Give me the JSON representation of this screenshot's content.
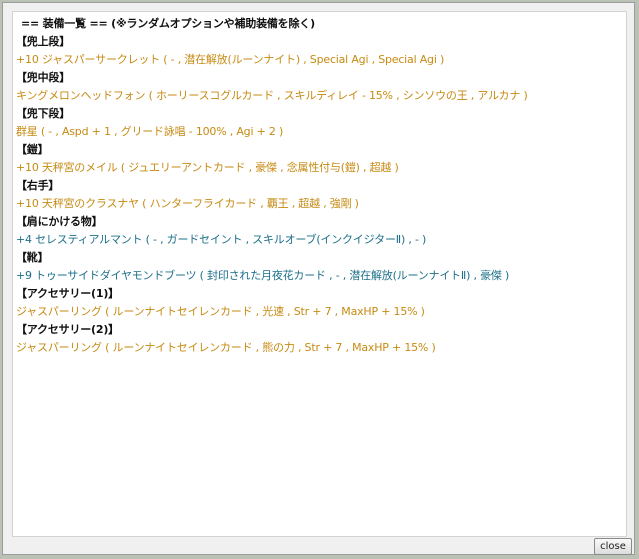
{
  "title": "== 装備一覧 == (※ランダムオプションや補助装備を除く)",
  "equipment": [
    {
      "slot": "【兜上段】",
      "item": "+10 ジャスパーサークレット ( - , 潜在解放(ルーンナイト) , Special Agi , Special Agi )",
      "color": "#c78a12"
    },
    {
      "slot": "【兜中段】",
      "item": "キングメロンヘッドフォン ( ホーリースコグルカード , スキルディレイ - 15% , シンソウの王 , アルカナ )",
      "color": "#c78a12"
    },
    {
      "slot": "【兜下段】",
      "item": "群星 ( - , Aspd + 1 , グリード詠唱 - 100% , Agi + 2 )",
      "color": "#c78a12"
    },
    {
      "slot": "【鎧】",
      "item": "+10 天秤宮のメイル ( ジュエリーアントカード , 豪傑 , 念属性付与(鎧) , 超越 )",
      "color": "#c78a12"
    },
    {
      "slot": "【右手】",
      "item": "+10 天秤宮のクラスナヤ ( ハンターフライカード , 覇王 , 超越 , 強剛 )",
      "color": "#c78a12"
    },
    {
      "slot": "【肩にかける物】",
      "item": "+4 セレスティアルマント ( - , ガードセイント , スキルオーブ(インクイジターⅡ) , - )",
      "color": "#1c6f8a"
    },
    {
      "slot": "【靴】",
      "item": "+9 トゥーサイドダイヤモンドブーツ ( 封印された月夜花カード , - , 潜在解放(ルーンナイトⅡ) , 豪傑 )",
      "color": "#1c6f8a"
    },
    {
      "slot": "【アクセサリー(1)】",
      "item": "ジャスパーリング ( ルーンナイトセイレンカード , 光速 , Str + 7 , MaxHP + 15% )",
      "color": "#c78a12"
    },
    {
      "slot": "【アクセサリー(2)】",
      "item": "ジャスパーリング ( ルーンナイトセイレンカード , 熊の力 , Str + 7 , MaxHP + 15% )",
      "color": "#c78a12"
    }
  ],
  "close_label": "close"
}
